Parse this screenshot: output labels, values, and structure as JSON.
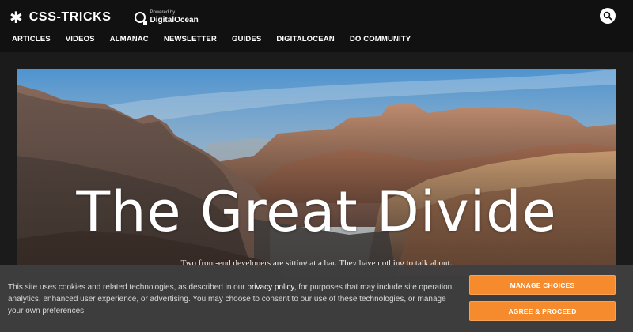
{
  "brand": {
    "logo_mark": "✱",
    "name": "CSS-TRICKS",
    "powered_by": "Powered by",
    "partner": "DigitalOcean",
    "partner_icon": "digitalocean-icon"
  },
  "search": {
    "icon": "search-icon"
  },
  "nav": {
    "items": [
      {
        "label": "ARTICLES"
      },
      {
        "label": "VIDEOS"
      },
      {
        "label": "ALMANAC"
      },
      {
        "label": "NEWSLETTER"
      },
      {
        "label": "GUIDES"
      },
      {
        "label": "DIGITALOCEAN"
      },
      {
        "label": "DO COMMUNITY"
      }
    ]
  },
  "hero": {
    "title": "The Great Divide",
    "subtitle": "Two front-end developers are sitting at a bar. They have nothing to talk about."
  },
  "cookie": {
    "text_before": "This site uses cookies and related technologies, as described in our ",
    "link_text": "privacy policy",
    "text_after": ", for purposes that may include site operation, analytics, enhanced user experience, or advertising. You may choose to consent to our use of these technologies, or manage your own preferences.",
    "manage_label": "MANAGE CHOICES",
    "agree_label": "AGREE & PROCEED",
    "accent_color": "#f58b2c"
  }
}
